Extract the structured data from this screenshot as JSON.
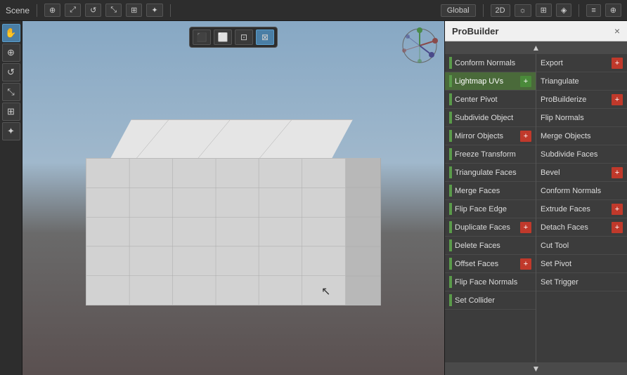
{
  "window": {
    "title": "Scene",
    "close_label": "×"
  },
  "top_bar": {
    "scene_label": "Scene",
    "buttons": [
      {
        "label": "⊕",
        "name": "transform-btn",
        "active": false
      },
      {
        "label": "⤢",
        "name": "move-btn",
        "active": false
      },
      {
        "label": "↺",
        "name": "rotate-btn",
        "active": false
      },
      {
        "label": "⤡",
        "name": "scale-btn",
        "active": false
      },
      {
        "label": "⊞",
        "name": "rect-btn",
        "active": false
      },
      {
        "label": "✦",
        "name": "multi-btn",
        "active": false
      }
    ],
    "right_buttons": [
      {
        "label": "2D",
        "name": "2d-btn"
      },
      {
        "label": "☼",
        "name": "light-btn"
      },
      {
        "label": "⊞",
        "name": "grid-btn"
      },
      {
        "label": "◈",
        "name": "cam-btn"
      },
      {
        "label": "≡",
        "name": "menu-btn"
      },
      {
        "label": "☰",
        "name": "layers-btn"
      },
      {
        "label": "⊕",
        "name": "gizmo-btn"
      }
    ]
  },
  "left_toolbar": {
    "buttons": [
      {
        "icon": "✋",
        "name": "hand-tool",
        "active": false
      },
      {
        "icon": "⊕",
        "name": "move-tool",
        "active": false
      },
      {
        "icon": "↺",
        "name": "rotate-tool",
        "active": false
      },
      {
        "icon": "⤡",
        "name": "scale-tool",
        "active": false
      },
      {
        "icon": "⊞",
        "name": "rect-tool",
        "active": false
      },
      {
        "icon": "✦",
        "name": "all-tool",
        "active": false
      }
    ]
  },
  "view_toolbar": {
    "buttons": [
      {
        "icon": "⬛",
        "name": "persp-btn",
        "active": false
      },
      {
        "icon": "⬜",
        "name": "iso-btn",
        "active": false
      },
      {
        "icon": "⊡",
        "name": "obj-btn",
        "active": false
      },
      {
        "icon": "⊠",
        "name": "scene-btn",
        "active": true
      }
    ]
  },
  "probuilder": {
    "title": "ProBuilder",
    "close": "×",
    "scroll_up": "▲",
    "scroll_down": "▼",
    "left_col": [
      {
        "label": "Conform Normals",
        "separator": true,
        "plus": false,
        "highlight": false
      },
      {
        "label": "Lightmap UVs",
        "separator": true,
        "plus": true,
        "plus_color": "green",
        "highlight": true
      },
      {
        "label": "Center Pivot",
        "separator": true,
        "plus": false,
        "highlight": false
      },
      {
        "label": "Subdivide Object",
        "separator": true,
        "plus": false,
        "highlight": false
      },
      {
        "label": "Mirror Objects",
        "separator": true,
        "plus": true,
        "plus_color": "red",
        "highlight": false
      },
      {
        "label": "Freeze Transform",
        "separator": true,
        "plus": false,
        "highlight": false
      },
      {
        "label": "Triangulate Faces",
        "separator": true,
        "plus": false,
        "highlight": false
      },
      {
        "label": "Merge Faces",
        "separator": true,
        "plus": false,
        "highlight": false
      },
      {
        "label": "Flip Face Edge",
        "separator": true,
        "plus": false,
        "highlight": false
      },
      {
        "label": "Duplicate Faces",
        "separator": true,
        "plus": true,
        "plus_color": "red",
        "highlight": false
      },
      {
        "label": "Delete Faces",
        "separator": true,
        "plus": false,
        "highlight": false
      },
      {
        "label": "Offset Faces",
        "separator": true,
        "plus": true,
        "plus_color": "red",
        "highlight": false
      },
      {
        "label": "Flip Face Normals",
        "separator": true,
        "plus": false,
        "highlight": false
      },
      {
        "label": "Set Collider",
        "separator": true,
        "plus": false,
        "highlight": false
      }
    ],
    "right_col": [
      {
        "label": "Export",
        "separator": false,
        "plus": true,
        "plus_color": "red",
        "highlight": false
      },
      {
        "label": "Triangulate",
        "separator": false,
        "plus": false,
        "highlight": false
      },
      {
        "label": "ProBuilderize",
        "separator": false,
        "plus": true,
        "plus_color": "red",
        "highlight": false
      },
      {
        "label": "Flip Normals",
        "separator": false,
        "plus": false,
        "highlight": false
      },
      {
        "label": "Merge Objects",
        "separator": false,
        "plus": false,
        "highlight": false
      },
      {
        "label": "Subdivide Faces",
        "separator": false,
        "plus": false,
        "highlight": false
      },
      {
        "label": "Bevel",
        "separator": false,
        "plus": true,
        "plus_color": "red",
        "highlight": false
      },
      {
        "label": "Conform Normals",
        "separator": false,
        "plus": false,
        "highlight": false
      },
      {
        "label": "Extrude Faces",
        "separator": false,
        "plus": true,
        "plus_color": "red",
        "highlight": false
      },
      {
        "label": "Detach Faces",
        "separator": false,
        "plus": true,
        "plus_color": "red",
        "highlight": false
      },
      {
        "label": "Cut Tool",
        "separator": false,
        "plus": false,
        "highlight": false
      },
      {
        "label": "Set Pivot",
        "separator": false,
        "plus": false,
        "highlight": false
      },
      {
        "label": "Set Trigger",
        "separator": false,
        "plus": false,
        "highlight": false
      }
    ]
  },
  "colors": {
    "separator_green": "#5a9a4a",
    "plus_red": "#c0392b",
    "plus_green": "#4a8a3a",
    "highlight_bg": "#4a6a3a",
    "panel_bg": "#3c3c3c",
    "header_bg": "#f0f0f0"
  }
}
